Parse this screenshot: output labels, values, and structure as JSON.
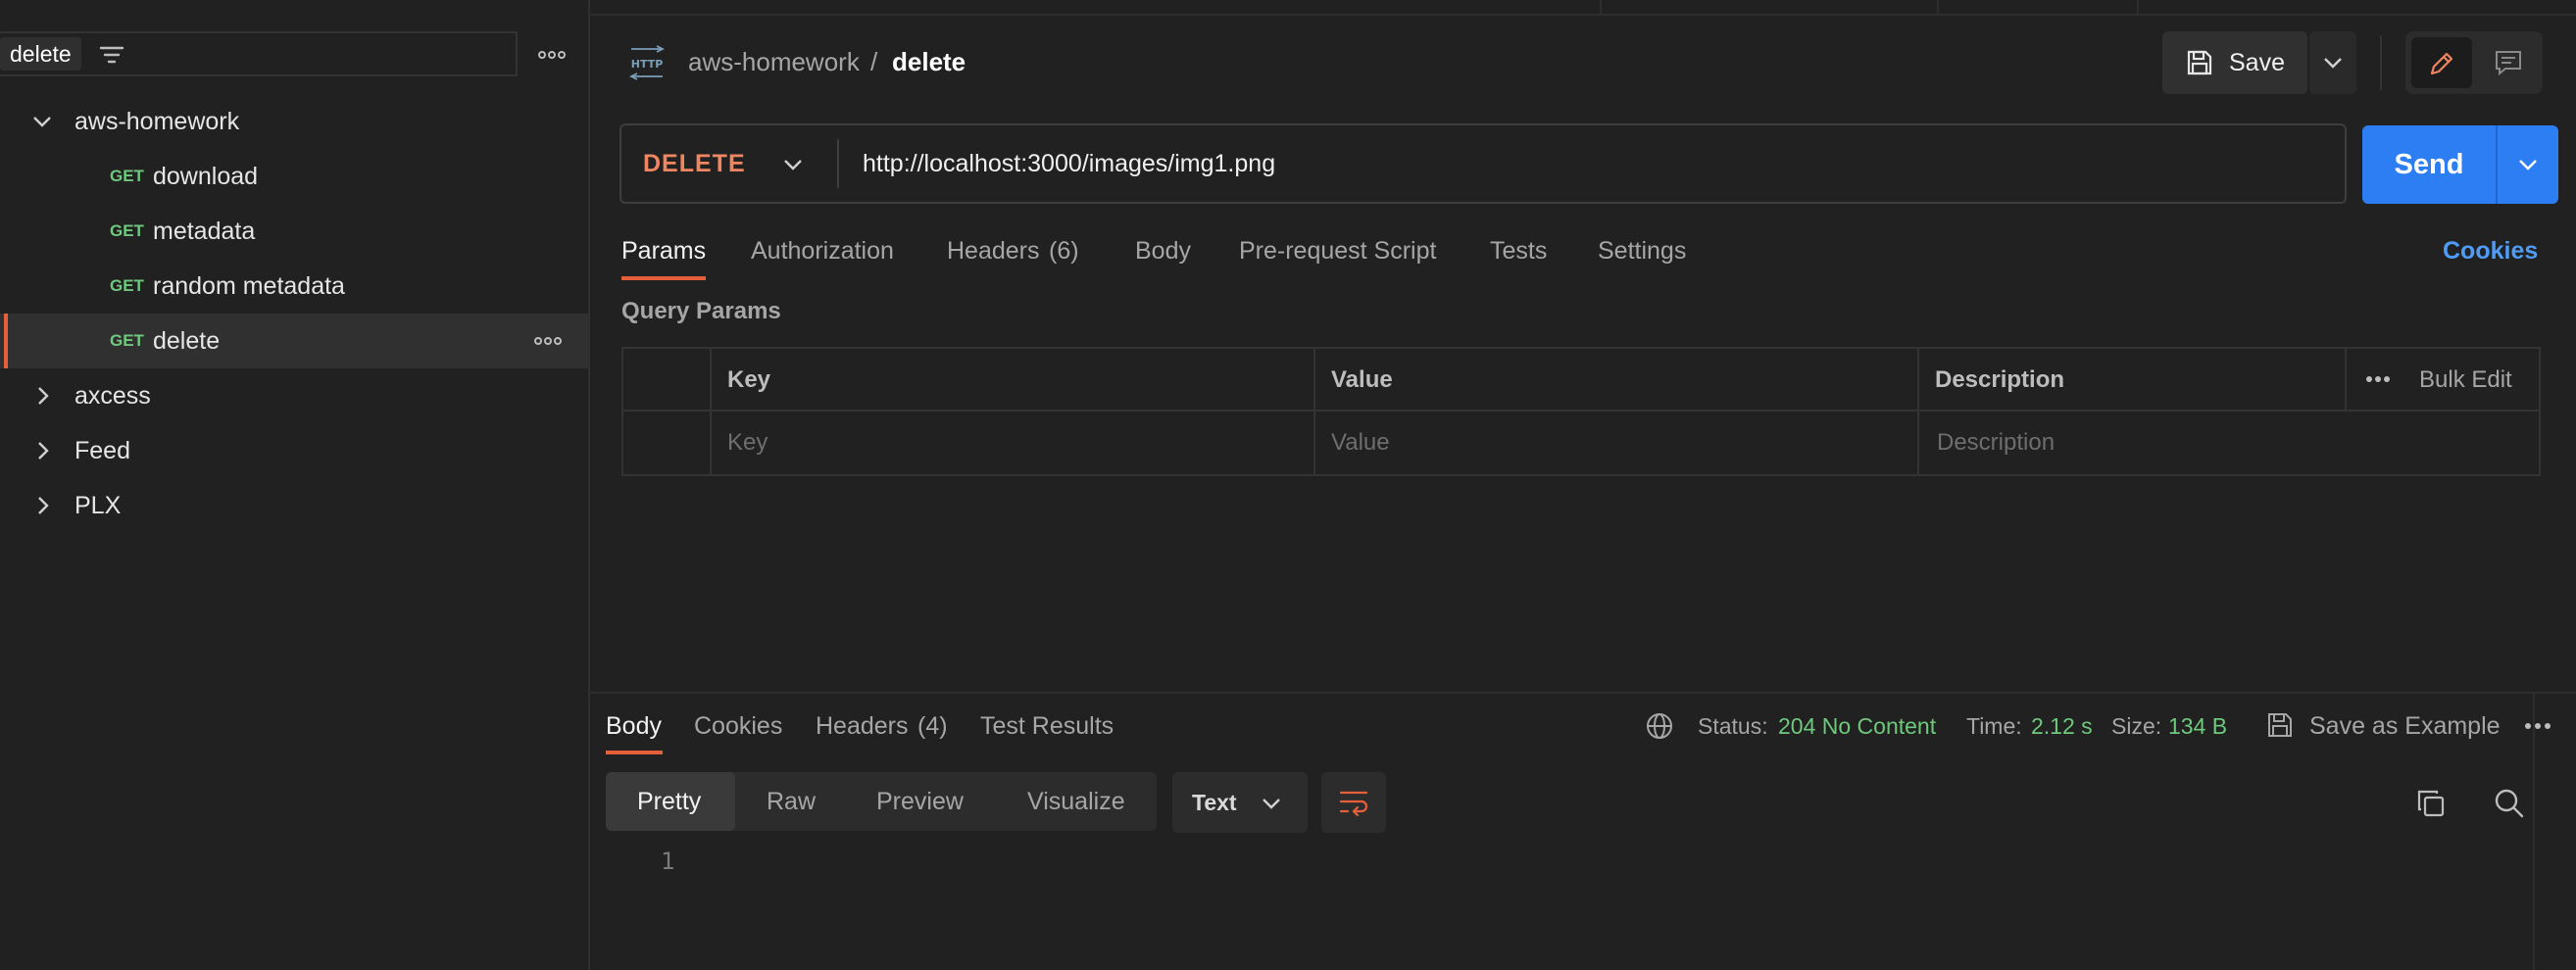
{
  "sidebar": {
    "search_value": "delete",
    "tree": [
      {
        "label": "aws-homework",
        "expanded": true,
        "children": [
          {
            "method": "GET",
            "label": "download"
          },
          {
            "method": "GET",
            "label": "metadata"
          },
          {
            "method": "GET",
            "label": "random metadata"
          },
          {
            "method": "GET",
            "label": "delete",
            "selected": true
          }
        ]
      },
      {
        "label": "axcess",
        "expanded": false
      },
      {
        "label": "Feed",
        "expanded": false
      },
      {
        "label": "PLX",
        "expanded": false
      }
    ]
  },
  "header": {
    "protocol_icon_text": "HTTP",
    "collection": "aws-homework",
    "separator": "/",
    "request_name": "delete",
    "save_label": "Save"
  },
  "request": {
    "method": "DELETE",
    "url": "http://localhost:3000/images/img1.png",
    "send_label": "Send",
    "tabs": [
      {
        "label": "Params",
        "active": true
      },
      {
        "label": "Authorization"
      },
      {
        "label": "Headers",
        "count": "(6)"
      },
      {
        "label": "Body"
      },
      {
        "label": "Pre-request Script"
      },
      {
        "label": "Tests"
      },
      {
        "label": "Settings"
      }
    ],
    "cookies_link": "Cookies",
    "query_params_title": "Query Params",
    "table": {
      "headers": [
        "Key",
        "Value",
        "Description"
      ],
      "bulk_edit": "Bulk Edit",
      "placeholders": [
        "Key",
        "Value",
        "Description"
      ]
    }
  },
  "response": {
    "tabs": [
      {
        "label": "Body",
        "active": true
      },
      {
        "label": "Cookies"
      },
      {
        "label": "Headers",
        "count": "(4)"
      },
      {
        "label": "Test Results"
      }
    ],
    "status_label": "Status:",
    "status_value": "204 No Content",
    "time_label": "Time:",
    "time_value": "2.12 s",
    "size_label": "Size:",
    "size_value": "134 B",
    "save_example": "Save as Example",
    "view_modes": [
      "Pretty",
      "Raw",
      "Preview",
      "Visualize"
    ],
    "format": "Text",
    "line_numbers": [
      "1"
    ]
  },
  "colors": {
    "accent": "#e5603a",
    "send": "#2d7ef2",
    "get_method": "#6ec97c",
    "delete_method": "#f08561",
    "link": "#4f9cf7"
  }
}
